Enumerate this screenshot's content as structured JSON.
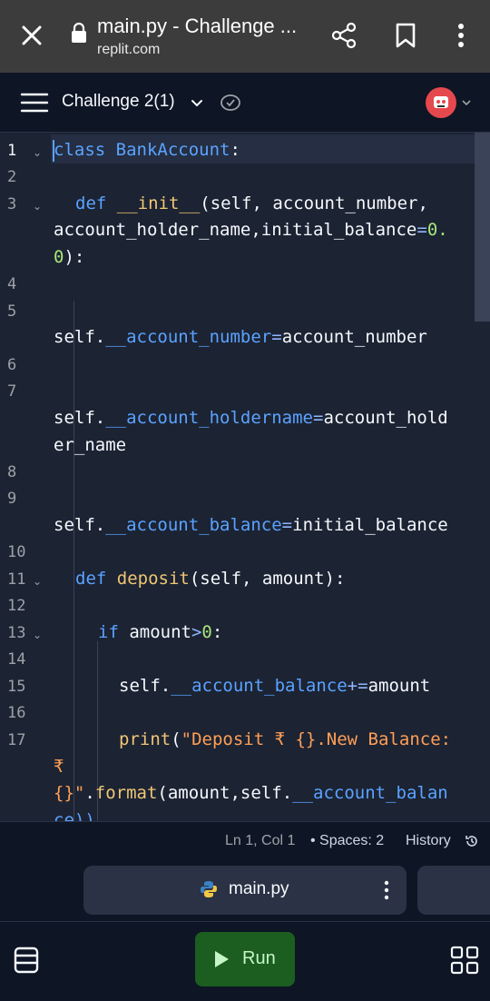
{
  "browser": {
    "title": "main.py - Challenge ...",
    "url": "replit.com"
  },
  "header": {
    "project_name": "Challenge 2(1)"
  },
  "editor": {
    "line_numbers": [
      "1",
      "2",
      "3",
      "4",
      "5",
      "6",
      "7",
      "8",
      "9",
      "10",
      "11",
      "12",
      "13",
      "14",
      "15",
      "16",
      "17"
    ],
    "code": {
      "l1_kw": "class",
      "l1_name": " BankAccount",
      "l1_rest": ":",
      "l3_kw": "def",
      "l3_fn": " __init__",
      "l3_rest": "(self, account_number,",
      "l3_cont1": "account_holder_name,initial_balance",
      "l3_eq": "=",
      "l3_num": "0.",
      "l3_cont2_num": "0",
      "l3_cont2_rest": "):",
      "l5_a": "self.",
      "l5_b": "__account_number",
      "l5_eq": "=",
      "l5_c": "account_number",
      "l7_a": "self.",
      "l7_b": "__account_holdername",
      "l7_eq": "=",
      "l7_c": "account_hold",
      "l7_cont": "er_name",
      "l9_a": "self.",
      "l9_b": "__account_balance",
      "l9_eq": "=",
      "l9_c": "initial_balance",
      "l11_kw": "def",
      "l11_fn": " deposit",
      "l11_rest": "(self, amount):",
      "l13_kw": "if",
      "l13_a": " amount",
      "l13_op": ">",
      "l13_num": "0",
      "l13_rest": ":",
      "l15_a": "self.",
      "l15_b": "__account_balance",
      "l15_op": "+=",
      "l15_c": "amount",
      "l17_fn": "print",
      "l17_paren": "(",
      "l17_str": "\"Deposit ₹ {}.New Balance:",
      "l17_cont1": "₹",
      "l17_cont2_str": "{}\"",
      "l17_cont2_dot": ".",
      "l17_cont2_fn": "format",
      "l17_cont2_rest": "(amount,self.",
      "l17_cont2_attr": "__account_balan",
      "l17_cont3": "ce))"
    }
  },
  "status": {
    "position": "Ln 1, Col 1",
    "spaces": "• Spaces: 2",
    "history": "History"
  },
  "tabs": {
    "active_file": "main.py"
  },
  "bottom": {
    "run_label": "Run"
  },
  "colors": {
    "keyword": "#5aa3ff",
    "function": "#f0c674",
    "number": "#a7e67a",
    "string": "#ff9f56",
    "run_button": "#1b5e20"
  }
}
